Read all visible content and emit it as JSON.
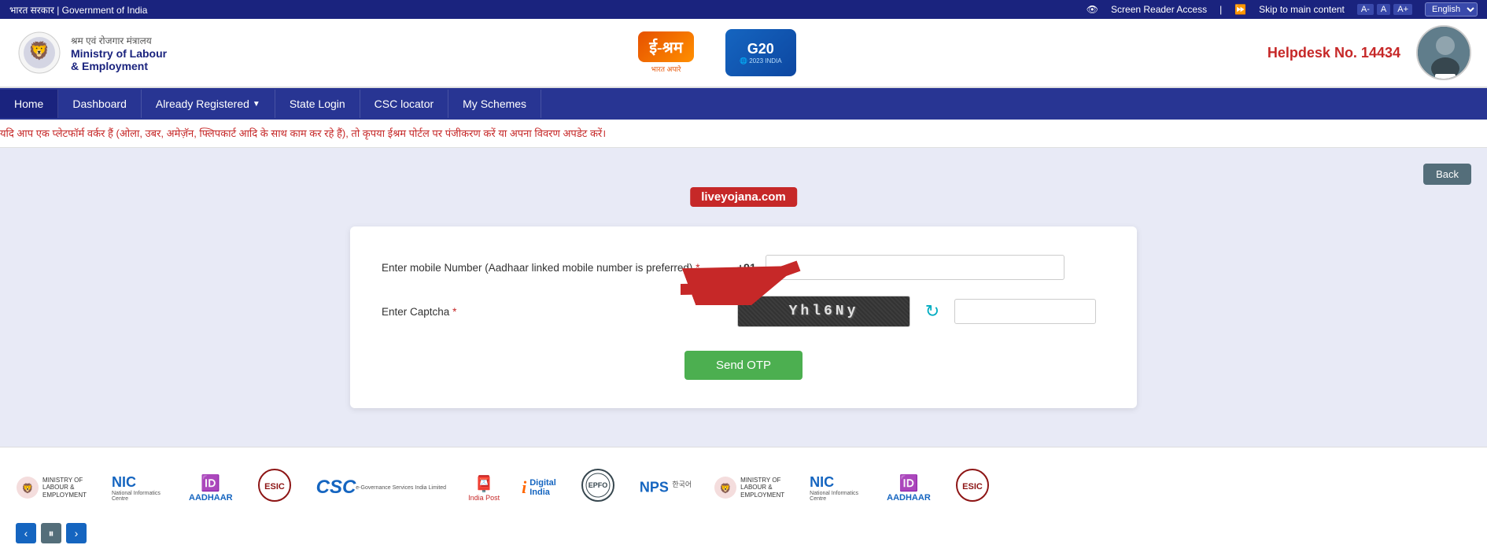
{
  "topbar": {
    "gov_text": "भारत सरकार | Government of India",
    "screen_reader": "Screen Reader Access",
    "skip_label": "Skip to main content",
    "font_a_small": "A-",
    "font_a_normal": "A",
    "font_a_large": "A+",
    "lang_selected": "English"
  },
  "header": {
    "ministry_hindi": "श्रम एवं रोजगार मंत्रालय",
    "ministry_line1": "Ministry of Labour",
    "ministry_line2": "& Employment",
    "eshram_label": "ई-श्रम",
    "eshram_sub": "भारत अपारे",
    "helpdesk_label": "Helpdesk No. 14434"
  },
  "nav": {
    "items": [
      {
        "label": "Home",
        "active": false
      },
      {
        "label": "Dashboard",
        "active": false
      },
      {
        "label": "Already Registered",
        "active": false,
        "has_dropdown": true
      },
      {
        "label": "State Login",
        "active": false
      },
      {
        "label": "CSC locator",
        "active": false
      },
      {
        "label": "My Schemes",
        "active": false
      }
    ]
  },
  "marquee": {
    "text": "यदि आप एक प्लेटफॉर्म वर्कर हैं (ओला, उबर, अमेज़ॅन, फ्लिपकार्ट आदि के साथ काम कर रहे हैं), तो कृपया ईश्रम पोर्टल पर पंजीकरण करें या अपना विवरण अपडेट करें।"
  },
  "watermark": {
    "text": "liveyojana.com"
  },
  "back_button": "Back",
  "form": {
    "mobile_label": "Enter mobile Number (Aadhaar linked mobile number is preferred)",
    "mobile_required": true,
    "phone_prefix": "+91",
    "captcha_label": "Enter Captcha",
    "captcha_required": true,
    "captcha_text": "Yhl6Ny",
    "captcha_input_placeholder": "",
    "send_otp_label": "Send OTP"
  },
  "footer": {
    "logos": [
      {
        "name": "Ministry of Labour & Employment",
        "type": "mol"
      },
      {
        "name": "NIC",
        "type": "nic"
      },
      {
        "name": "AADHAAR",
        "type": "aadhaar"
      },
      {
        "name": "ESIC",
        "type": "esic"
      },
      {
        "name": "CSC",
        "type": "csc"
      },
      {
        "name": "India Post",
        "type": "post"
      },
      {
        "name": "Digital India",
        "type": "digital"
      },
      {
        "name": "EPFO",
        "type": "epfo"
      },
      {
        "name": "NPS",
        "type": "nps"
      },
      {
        "name": "Ministry of Labour & Employment 2",
        "type": "mol"
      },
      {
        "name": "NIC 2",
        "type": "nic"
      },
      {
        "name": "AADHAAR 2",
        "type": "aadhaar"
      },
      {
        "name": "ESIC 2",
        "type": "esic"
      }
    ],
    "carousel_prev": "‹",
    "carousel_pause": "⏸",
    "carousel_next": "›"
  }
}
